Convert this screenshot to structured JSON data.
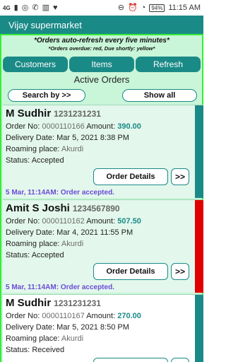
{
  "status_bar": {
    "network": "4G",
    "time": "11:15 AM",
    "battery": "94%",
    "icons": [
      "signal-icon",
      "whatsapp-icon",
      "call-icon",
      "chart-icon",
      "heart-icon",
      "minus-circle-icon",
      "alarm-icon",
      "wifi-icon",
      "battery-icon"
    ]
  },
  "app": {
    "title": "Vijay supermarket"
  },
  "notice": {
    "line1": "*Orders auto-refresh every five minutes*",
    "line2": "*Orders overdue: red, Due shortly: yellow*"
  },
  "nav": {
    "customers": "Customers",
    "items": "Items",
    "refresh": "Refresh"
  },
  "section_title": "Active Orders",
  "search": {
    "search_by": "Search by >>",
    "show_all": "Show all"
  },
  "labels": {
    "order_no": "Order No:",
    "amount": "Amount:",
    "delivery_date": "Delivery Date:",
    "roaming_place": "Roaming place:",
    "status": "Status:",
    "order_details": "Order Details",
    "more": ">>"
  },
  "orders": [
    {
      "name": "M Sudhir",
      "phone": "1231231231",
      "order_no": "0000110166",
      "amount": "390.00",
      "delivery_date": "Mar 5, 2021 8:38 PM",
      "roaming_place": "Akurdi",
      "status": "Accepted",
      "log": "5 Mar, 11:14AM: Order accepted.",
      "stripe_color": "#1a8a87"
    },
    {
      "name": "Amit S Joshi",
      "phone": "1234567890",
      "order_no": "0000110162",
      "amount": "507.50",
      "delivery_date": "Mar 4, 2021 11:55 PM",
      "roaming_place": "Akurdi",
      "status": "Accepted",
      "log": "5 Mar, 11:14AM: Order accepted.",
      "stripe_color": "#e00000"
    },
    {
      "name": "M Sudhir",
      "phone": "1231231231",
      "order_no": "0000110167",
      "amount": "270.00",
      "delivery_date": "Mar 5, 2021 8:50 PM",
      "roaming_place": "Akurdi",
      "status": "Received",
      "log": "",
      "stripe_color": "#1a8a87"
    }
  ],
  "colors": {
    "accent": "#1a8a87",
    "frame_border": "#35ee35",
    "overdue": "#e00000",
    "log_text": "#6a4cd6"
  }
}
